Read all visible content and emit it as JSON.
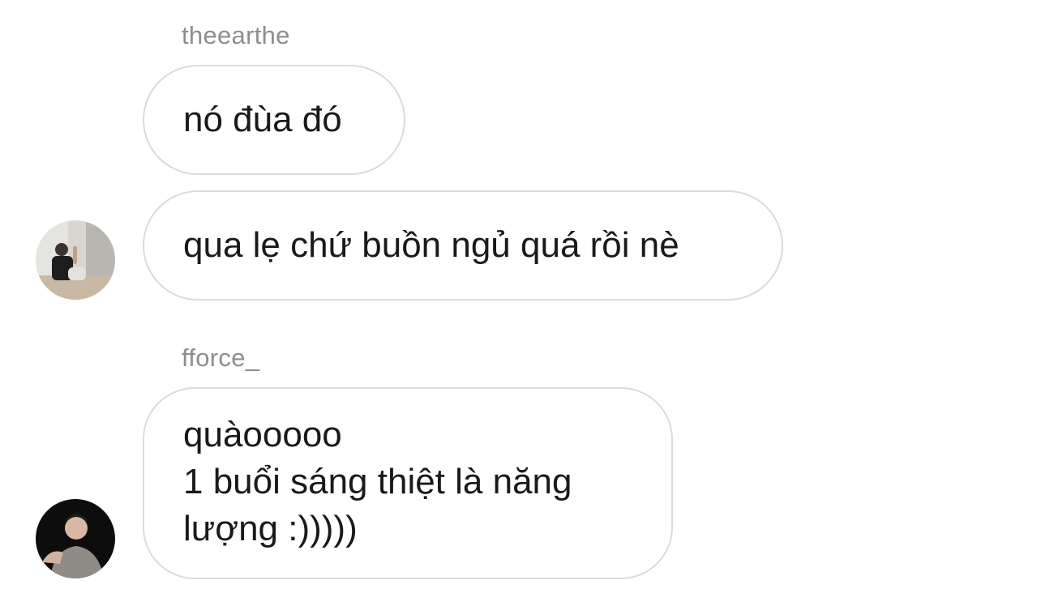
{
  "conversation": {
    "groups": [
      {
        "sender": "theearthe",
        "messages": [
          "nó đùa đó",
          "qua lẹ chứ buồn ngủ quá rồi nè"
        ],
        "avatar_icon": "user-avatar-photo-light-room"
      },
      {
        "sender": "fforce_",
        "messages": [
          [
            "quàooooo",
            "1 buổi sáng thiệt là năng",
            "lượng :)))))"
          ]
        ],
        "avatar_icon": "user-avatar-photo-dark"
      }
    ]
  },
  "colors": {
    "bubble_border": "#dbdbdb",
    "sender_text": "#8e8e8e",
    "message_text": "#1a1a1a",
    "background": "#ffffff"
  }
}
